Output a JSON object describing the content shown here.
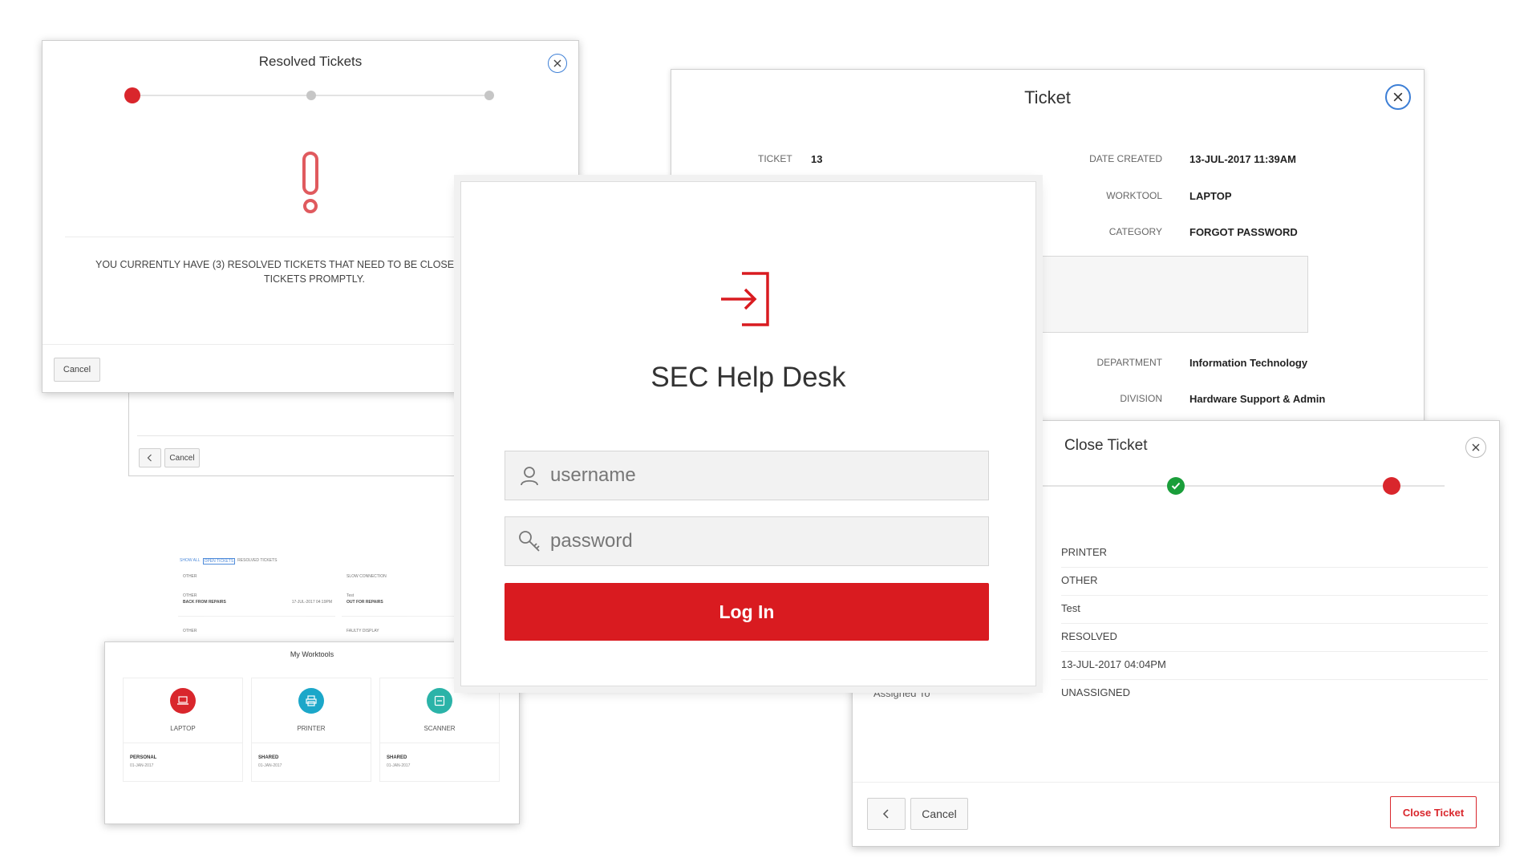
{
  "resolved_dialog": {
    "title": "Resolved Tickets",
    "message_line1": "YOU CURRENTLY HAVE (3) RESOLVED TICKETS THAT NEED TO BE CLOSED! PLEA",
    "message_line2": "TICKETS PROMPTLY.",
    "cancel_label": "Cancel",
    "step_colors": [
      "#d9262c",
      "#bdbdbd",
      "#bdbdbd"
    ]
  },
  "behind_dialog": {
    "back_icon": "chevron-left-icon",
    "cancel_label": "Cancel"
  },
  "ticket_dialog": {
    "title": "Ticket",
    "ticket_label": "TICKET",
    "ticket_value": "13",
    "date_label": "DATE CREATED",
    "date_value": "13-JUL-2017 11:39AM",
    "worktool_label": "WORKTOOL",
    "worktool_value": "LAPTOP",
    "category_label": "CATEGORY",
    "category_value": "FORGOT PASSWORD",
    "department_label": "DEPARTMENT",
    "department_value": "Information Technology",
    "division_label": "DIVISION",
    "division_value": "Hardware Support & Admin"
  },
  "tickets_list": {
    "filters": [
      "SHOW ALL",
      "OPEN TICKETS",
      "RESOLVED TICKETS"
    ],
    "cards": [
      {
        "top": "OTHER",
        "sub": "OTHER",
        "title": "BACK FROM REPAIRS",
        "date": "17-JUL-2017 04:19PM"
      },
      {
        "top": "SLOW CONNECTION",
        "sub": "Test",
        "title": "OUT FOR REPAIRS",
        "date": ""
      }
    ],
    "row3": [
      "OTHER",
      "FAULTY DISPLAY"
    ]
  },
  "worktools": {
    "title": "My Worktools",
    "items": [
      {
        "name": "LAPTOP",
        "type": "PERSONAL",
        "date": "01-JAN-2017",
        "color": "#d9262c",
        "icon": "laptop-icon"
      },
      {
        "name": "PRINTER",
        "type": "SHARED",
        "date": "01-JAN-2017",
        "color": "#1ba7c9",
        "icon": "printer-icon"
      },
      {
        "name": "SCANNER",
        "type": "SHARED",
        "date": "01-JAN-2017",
        "color": "#2bb3a8",
        "icon": "scanner-icon"
      }
    ]
  },
  "login": {
    "app_title": "SEC Help Desk",
    "username_placeholder": "username",
    "password_placeholder": "password",
    "login_label": "Log In",
    "accent": "#d91b20"
  },
  "close_ticket": {
    "title": "Close Ticket",
    "rows": [
      "PRINTER",
      "OTHER",
      "Test",
      "RESOLVED",
      "13-JUL-2017 04:04PM",
      "UNASSIGNED"
    ],
    "assigned_label": "Assigned To",
    "cancel_label": "Cancel",
    "close_label": "Close Ticket",
    "step_colors": [
      "#1a9e3a",
      "#d9262c"
    ]
  }
}
